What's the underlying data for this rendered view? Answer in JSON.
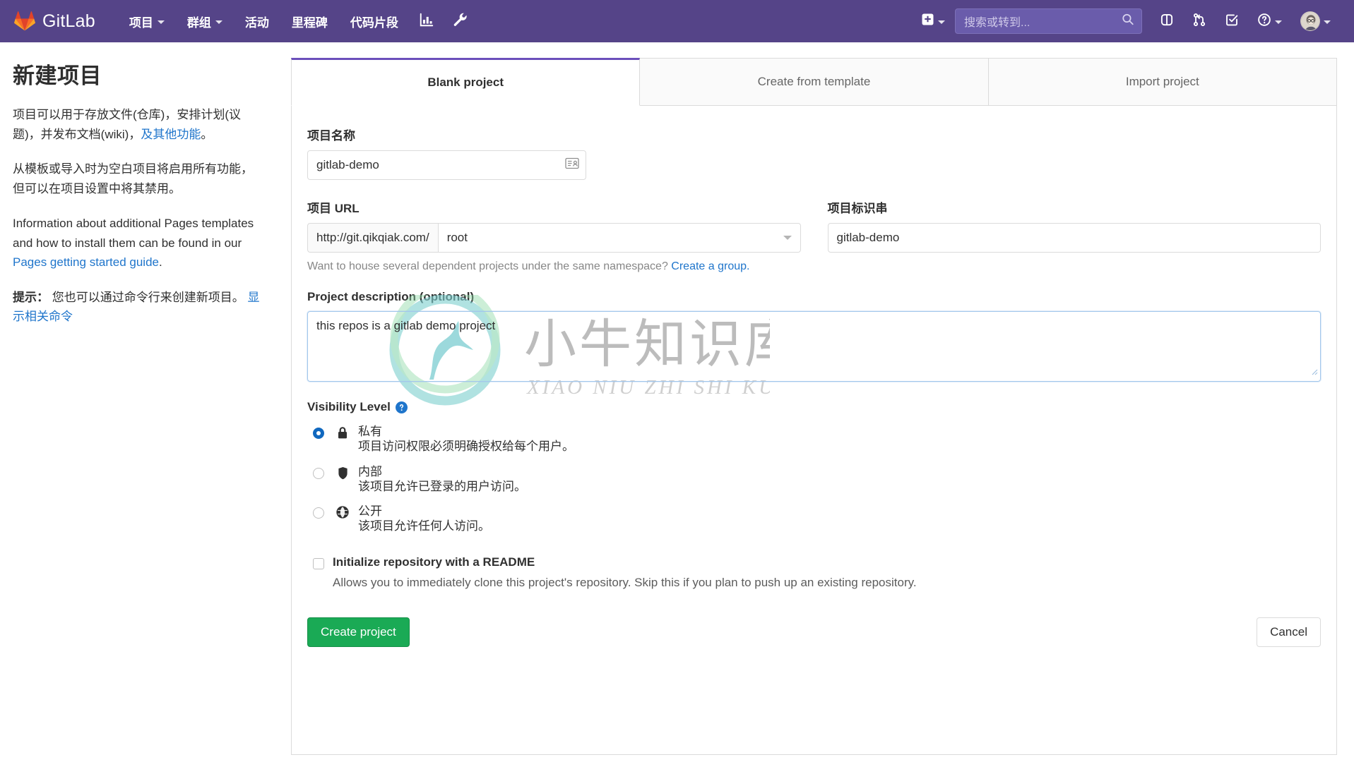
{
  "navbar": {
    "brand": "GitLab",
    "items": [
      {
        "label": "项目",
        "caret": true,
        "icon": null
      },
      {
        "label": "群组",
        "caret": true,
        "icon": null
      },
      {
        "label": "活动",
        "caret": false,
        "icon": null
      },
      {
        "label": "里程碑",
        "caret": false,
        "icon": null
      },
      {
        "label": "代码片段",
        "caret": false,
        "icon": null
      }
    ],
    "icon_items": [
      {
        "name": "analytics-icon"
      },
      {
        "name": "wrench-icon"
      }
    ],
    "plus_label": "+",
    "search": {
      "placeholder": "搜索或转到...",
      "value": ""
    },
    "right_icons": [
      {
        "name": "issues-icon"
      },
      {
        "name": "merge-requests-icon"
      },
      {
        "name": "todos-icon"
      },
      {
        "name": "help-icon"
      }
    ],
    "brand_color": "#554488"
  },
  "sidebar": {
    "title": "新建项目",
    "p1_before": "项目可以用于存放文件(仓库)，安排计划(议题)，并发布文档(wiki)，",
    "p1_link": "及其他功能",
    "p1_after": "。",
    "p2": "从模板或导入时为空白项目将启用所有功能，但可以在项目设置中将其禁用。",
    "p3_before": "Information about additional Pages templates and how to install them can be found in our ",
    "p3_link": "Pages getting started guide",
    "p3_after": ".",
    "tip_label": "提示：",
    "tip_text": " 您也可以通过命令行来创建新项目。 ",
    "tip_link": "显示相关命令"
  },
  "tabs": [
    {
      "label": "Blank project",
      "active": true
    },
    {
      "label": "Create from template",
      "active": false
    },
    {
      "label": "Import project",
      "active": false
    }
  ],
  "form": {
    "project_name": {
      "label": "项目名称",
      "value": "gitlab-demo",
      "placeholder": ""
    },
    "project_url": {
      "label": "项目 URL",
      "prefix": "http://git.qikqiak.com/",
      "namespace": "root"
    },
    "project_slug": {
      "label": "项目标识串",
      "value": "gitlab-demo",
      "placeholder": ""
    },
    "namespace_help_before": "Want to house several dependent projects under the same namespace? ",
    "namespace_help_link": "Create a group.",
    "description": {
      "label": "Project description (optional)",
      "value": "this repos is a gitlab demo project",
      "placeholder": ""
    },
    "visibility": {
      "title": "Visibility Level",
      "options": [
        {
          "icon": "lock-icon",
          "name": "私有",
          "desc": "项目访问权限必须明确授权给每个用户。",
          "selected": true
        },
        {
          "icon": "shield-icon",
          "name": "内部",
          "desc": "该项目允许已登录的用户访问。",
          "selected": false
        },
        {
          "icon": "globe-icon",
          "name": "公开",
          "desc": "该项目允许任何人访问。",
          "selected": false
        }
      ]
    },
    "readme": {
      "label": "Initialize repository with a README",
      "desc": "Allows you to immediately clone this project's repository. Skip this if you plan to push up an existing repository.",
      "checked": false
    }
  },
  "actions": {
    "create_label": "Create project",
    "cancel_label": "Cancel",
    "create_color": "#1aaa55"
  },
  "watermark": {
    "cn": "小牛知识库",
    "pinyin": "XIAO NIU ZHI SHI KU"
  }
}
